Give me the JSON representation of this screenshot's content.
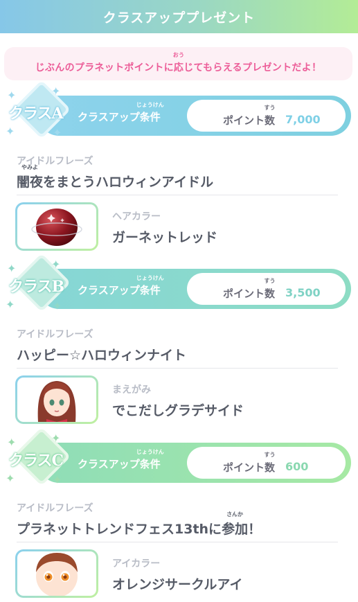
{
  "header": {
    "title": "クラスアッププレゼント"
  },
  "intro": {
    "text_before": "じぶんのプラネットポイントに",
    "ruby_base": "応",
    "ruby_text": "おう",
    "text_after": "じてもらえるプレゼントだよ！"
  },
  "classes": [
    {
      "badge": "クラスA",
      "condition_label": "クラスアップ条件",
      "condition_ruby": "じょうけん",
      "points_label": "ポイント",
      "points_kanji": "数",
      "points_ruby": "すう",
      "points_value": "7,000",
      "phrase_category": "アイドルフレーズ",
      "phrase_ruby_base": "闇夜",
      "phrase_ruby_text": "やみよ",
      "phrase_rest": "をまとうハロウィンアイドル",
      "item_category": "ヘアカラー",
      "item_name": "ガーネットレッド",
      "thumb_icon": "hair-color-icon",
      "colors": {
        "banner_from": "#8dd3ec",
        "banner_to": "#7ed0e0",
        "value": "#7fd0e6",
        "diamond": "#bfe8f2"
      }
    },
    {
      "badge": "クラスB",
      "condition_label": "クラスアップ条件",
      "condition_ruby": "じょうけん",
      "points_label": "ポイント",
      "points_kanji": "数",
      "points_ruby": "すう",
      "points_value": "3,500",
      "phrase_category": "アイドルフレーズ",
      "phrase_text": "ハッピー☆ハロウィンナイト",
      "item_category": "まえがみ",
      "item_name": "でこだしグラデサイド",
      "thumb_icon": "bangs-icon",
      "colors": {
        "banner_from": "#86d6d6",
        "banner_to": "#8ddcc4",
        "value": "#7fd2c4",
        "diamond": "#bdeadf"
      }
    },
    {
      "badge": "クラスC",
      "condition_label": "クラスアップ条件",
      "condition_ruby": "じょうけん",
      "points_label": "ポイント",
      "points_kanji": "数",
      "points_ruby": "すう",
      "points_value": "600",
      "phrase_category": "アイドルフレーズ",
      "phrase_text_before": "プラネットトレンドフェス13thに",
      "phrase_ruby_base": "参加",
      "phrase_ruby_text": "さんか",
      "phrase_text_after": "！",
      "item_category": "アイカラー",
      "item_name": "オレンジサークルアイ",
      "thumb_icon": "eye-color-icon",
      "colors": {
        "banner_from": "#8fddb8",
        "banner_to": "#a6e9a4",
        "value": "#8ad8b0",
        "diamond": "#c7efd0"
      }
    }
  ]
}
